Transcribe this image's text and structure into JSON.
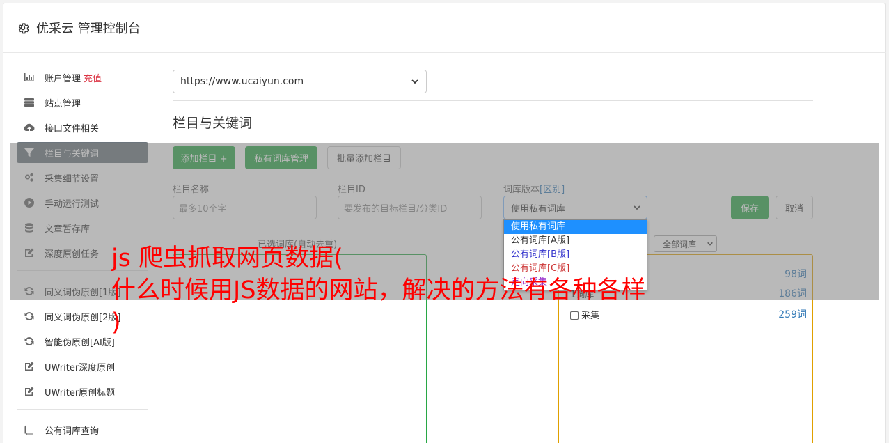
{
  "header": {
    "title": "优采云 管理控制台"
  },
  "sidebar": {
    "items": [
      {
        "label": "账户管理",
        "extra": "充值",
        "icon": "bar-chart-icon"
      },
      {
        "label": "站点管理",
        "icon": "server-icon"
      },
      {
        "label": "接口文件相关",
        "icon": "cloud-upload-icon"
      },
      {
        "label": "栏目与关键词",
        "icon": "filter-icon"
      },
      {
        "label": "采集细节设置",
        "icon": "cogs-icon"
      },
      {
        "label": "手动运行测试",
        "icon": "play-icon"
      },
      {
        "label": "文章暂存库",
        "icon": "database-icon"
      },
      {
        "label": "深度原创任务",
        "icon": "edit-icon"
      },
      {
        "label": "同义词伪原创[1版]",
        "icon": "refresh-icon"
      },
      {
        "label": "同义词伪原创[2版]",
        "icon": "refresh-icon"
      },
      {
        "label": "智能伪原创[AI版]",
        "icon": "refresh-icon"
      },
      {
        "label": "UWriter深度原创",
        "icon": "edit-icon"
      },
      {
        "label": "UWriter原创标题",
        "icon": "edit-icon"
      },
      {
        "label": "公有词库查询",
        "icon": "book-icon"
      }
    ]
  },
  "main": {
    "site_select": "https://www.ucaiyun.com",
    "section_title": "栏目与关键词",
    "buttons": {
      "add_column": "添加栏目 +",
      "private_lib": "私有词库管理",
      "batch_add": "批量添加栏目"
    },
    "form": {
      "name_label": "栏目名称",
      "name_placeholder": "最多10个字",
      "id_label": "栏目ID",
      "id_placeholder": "要发布的目标栏目/分类ID",
      "lib_label": "词库版本",
      "lib_label_link": "[区别]",
      "lib_selected": "使用私有词库",
      "save": "保存",
      "cancel": "取消"
    },
    "dropdown_options": [
      {
        "label": "使用私有词库",
        "color": "#ffffff"
      },
      {
        "label": "公有词库[A版]",
        "color": "#333333"
      },
      {
        "label": "公有词库[B版]",
        "color": "#3333cc"
      },
      {
        "label": "公有词库[C版]",
        "color": "#cc3333"
      },
      {
        "label": "定向采集",
        "color": "#9933cc"
      }
    ],
    "left_panel_title": "已选词库(自动去重)",
    "filter_select": "全部词库",
    "libraries": [
      {
        "name": "",
        "count": "98词"
      },
      {
        "name": "1词库",
        "count": "186词"
      },
      {
        "name": "采集",
        "count": "259词"
      }
    ]
  },
  "banner": {
    "line1": "js 爬虫抓取网页数据(",
    "line2": "什么时候用JS数据的网站，解决的方法有各种各样",
    "line3": ")"
  }
}
